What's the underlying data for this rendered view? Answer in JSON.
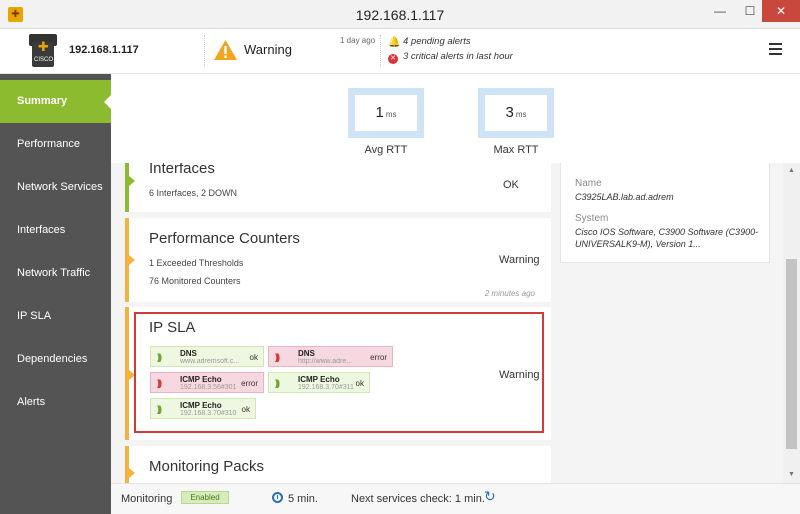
{
  "window": {
    "title": "192.168.1.117",
    "min_glyph": "—",
    "max_glyph": "☐",
    "close_glyph": "✕"
  },
  "header": {
    "device_ip": "192.168.1.117",
    "status": "Warning",
    "status_time": "1 day ago",
    "alerts": [
      {
        "icon": "bell-icon",
        "text": "4 pending alerts"
      },
      {
        "icon": "error-circle-icon",
        "text": "3 critical alerts in last hour"
      }
    ]
  },
  "sidebar": {
    "items": [
      {
        "label": "Summary",
        "active": true
      },
      {
        "label": "Performance",
        "active": false
      },
      {
        "label": "Network Services",
        "active": false
      },
      {
        "label": "Interfaces",
        "active": false
      },
      {
        "label": "Network Traffic",
        "active": false
      },
      {
        "label": "IP SLA",
        "active": false
      },
      {
        "label": "Dependencies",
        "active": false
      },
      {
        "label": "Alerts",
        "active": false
      }
    ]
  },
  "rtt": {
    "avg": {
      "value": "1",
      "unit": "ms",
      "label": "Avg RTT"
    },
    "max": {
      "value": "3",
      "unit": "ms",
      "label": "Max RTT"
    }
  },
  "cards": {
    "interfaces": {
      "title": "Interfaces",
      "line1": "6 Interfaces, 2 DOWN",
      "status": "OK"
    },
    "performance": {
      "title": "Performance Counters",
      "line1": "1 Exceeded Thresholds",
      "line2": "76 Monitored Counters",
      "status": "Warning",
      "ago": "2 minutes ago"
    },
    "ipsla": {
      "title": "IP SLA",
      "status": "Warning",
      "tiles": [
        {
          "name": "DNS",
          "addr": "www.adremsoft.c...",
          "state": "ok"
        },
        {
          "name": "DNS",
          "addr": "http://www.adre...",
          "state": "error"
        },
        {
          "name": "ICMP Echo",
          "addr": "192.168.3.56#301",
          "state": "error"
        },
        {
          "name": "ICMP Echo",
          "addr": "192.168.3.70#311",
          "state": "ok"
        },
        {
          "name": "ICMP Echo",
          "addr": "192.168.3.70#310",
          "state": "ok"
        }
      ]
    },
    "packs": {
      "title": "Monitoring Packs"
    }
  },
  "details": {
    "name_label": "Name",
    "name_value": "C3925LAB.lab.ad.adrem",
    "system_label": "System",
    "system_value": "Cisco IOS Software, C3900 Software (C3900-UNIVERSALK9-M), Version 1..."
  },
  "statusbar": {
    "monitoring_label": "Monitoring",
    "monitoring_state": "Enabled",
    "interval": "5 min.",
    "next_check": "Next services check: 1 min."
  },
  "colors": {
    "accent_green": "#8cbb2f",
    "warning_orange": "#f3b33c",
    "error_red": "#d43a3a",
    "sidebar_bg": "#545454"
  }
}
